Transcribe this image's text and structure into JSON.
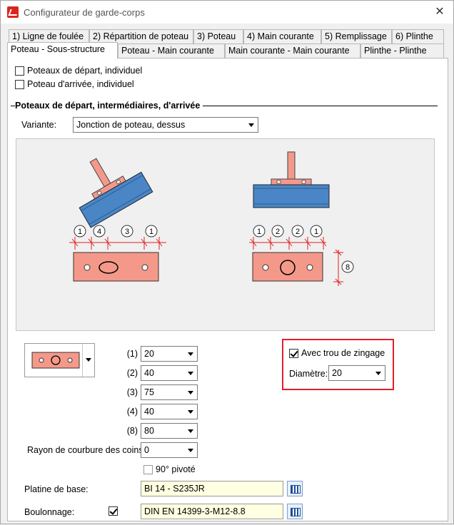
{
  "window": {
    "title": "Configurateur de garde-corps"
  },
  "tabs_row1": [
    "1) Ligne de foulée",
    "2) Répartition de poteau",
    "3) Poteau",
    "4) Main courante",
    "5) Remplissage",
    "6) Plinthe"
  ],
  "tabs_row2": [
    "Poteau - Sous-structure",
    "Poteau - Main courante",
    "Main courante - Main courante",
    "Plinthe - Plinthe"
  ],
  "options": {
    "start_post": {
      "label": "Poteaux de départ, individuel",
      "checked": false
    },
    "end_post": {
      "label": "Poteau d'arrivée, individuel",
      "checked": false
    }
  },
  "section": {
    "title": "Poteaux de départ, intermédiaires, d'arrivée",
    "variant_label": "Variante:",
    "variant_value": "Jonction de poteau, dessus"
  },
  "diagram": {
    "left_dims": [
      "1",
      "4",
      "3",
      "1"
    ],
    "right_dims": [
      "1",
      "2",
      "2",
      "1"
    ],
    "side_dim": "8"
  },
  "params": [
    {
      "key": "(1)",
      "value": "20"
    },
    {
      "key": "(2)",
      "value": "40"
    },
    {
      "key": "(3)",
      "value": "75"
    },
    {
      "key": "(4)",
      "value": "40"
    },
    {
      "key": "(8)",
      "value": "80"
    }
  ],
  "corner_radius": {
    "label": "Rayon de courbure des coins:",
    "value": "0"
  },
  "rotated": {
    "label": "90° pivoté",
    "checked": false
  },
  "galvanizing": {
    "label": "Avec trou de zingage",
    "checked": true,
    "diameter_label": "Diamètre:",
    "diameter_value": "20"
  },
  "base_plate": {
    "label": "Platine de base:",
    "value": "BI 14 - S235JR"
  },
  "bolting": {
    "label": "Boulonnage:",
    "checked": true,
    "value": "DIN EN 14399-3-M12-8.8"
  },
  "colors": {
    "plate": "#f4998a",
    "beam": "#4a86c5",
    "accent": "#0078d7",
    "highlight": "#e0202a"
  }
}
